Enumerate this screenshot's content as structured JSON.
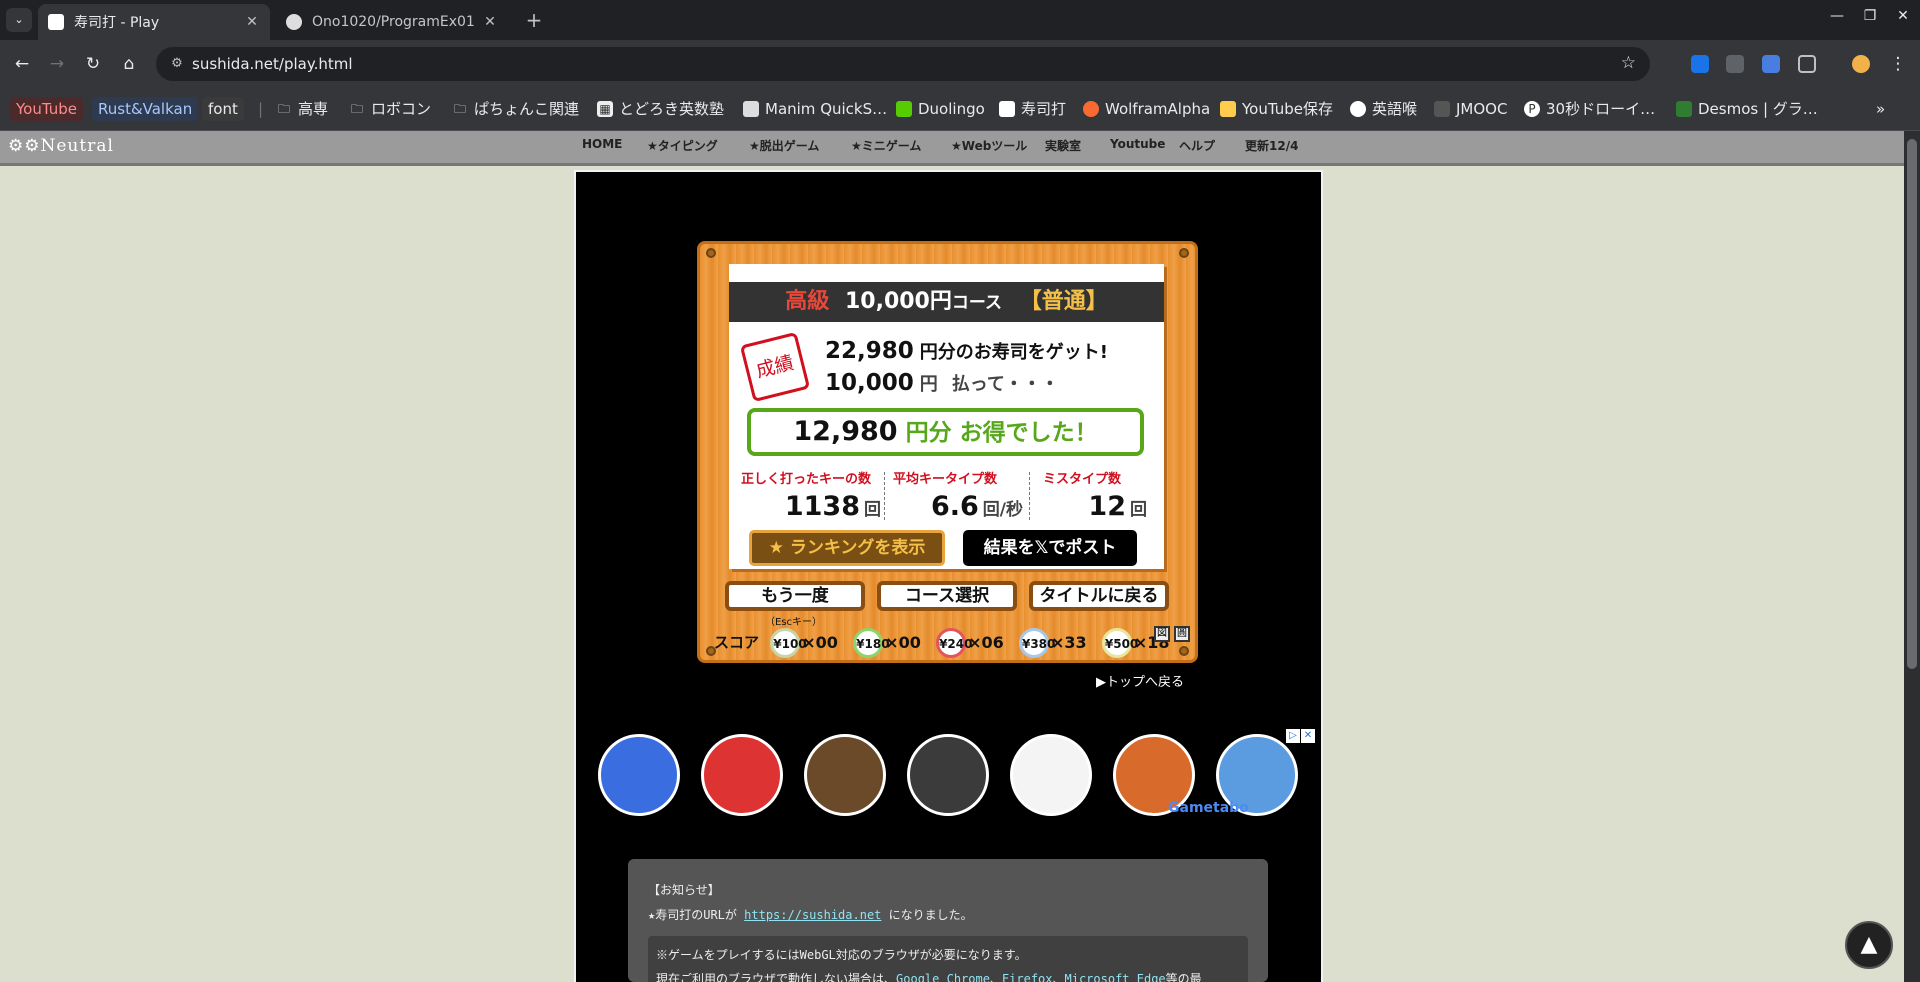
{
  "browser": {
    "tabs": [
      {
        "title": "寿司打 - Play",
        "active": true
      },
      {
        "title": "Ono1020/ProgramEx01",
        "active": false
      }
    ],
    "url": "sushida.net/play.html",
    "bookmarks": [
      "YouTube",
      "Rust&Valkan",
      "font",
      "高専",
      "ロボコン",
      "ぱちょんこ関連",
      "とどろき英数塾",
      "Manim QuickS…",
      "Duolingo",
      "寿司打",
      "WolframAlpha",
      "YouTube保存",
      "英語喉",
      "JMOOC",
      "30秒ドローイ…",
      "Desmos | グラ…"
    ],
    "bookmarks_overflow": "»"
  },
  "site": {
    "logo": "Neutral",
    "nav": [
      "HOME",
      "★タイピング",
      "★脱出ゲーム",
      "★ミニゲーム",
      "★Webツール",
      "実験室",
      "Youtube",
      "ヘルプ",
      "更新12/4"
    ]
  },
  "result": {
    "course_grade": "高級",
    "course_amount": "10,000円",
    "course_suffix": "コース",
    "difficulty": "【普通】",
    "stamp": "成績",
    "earned_value": "22,980",
    "earned_text": "円分のお寿司をゲット!",
    "paid_value": "10,000",
    "paid_unit": "円",
    "paid_text": "払って・・・",
    "profit_value": "12,980",
    "profit_text": "円分 お得でした！",
    "stats": [
      {
        "label": "正しく打ったキーの数",
        "value": "1138",
        "unit": "回"
      },
      {
        "label": "平均キータイプ数",
        "value": "6.6",
        "unit": "回/秒"
      },
      {
        "label": "ミスタイプ数",
        "value": "12",
        "unit": "回"
      }
    ],
    "ranking_button": "ランキングを表示",
    "post_button": "結果を𝕏でポスト",
    "retry_button": "もう一度",
    "retry_hint": "（Escキー）",
    "course_button": "コース選択",
    "title_button": "タイトルに戻る",
    "score_label": "スコア",
    "plates": [
      {
        "price": "¥100",
        "count": "×00",
        "color": "#c9d4a8"
      },
      {
        "price": "¥180",
        "count": "×00",
        "color": "#8fd36b"
      },
      {
        "price": "¥240",
        "count": "×06",
        "color": "#e2555f"
      },
      {
        "price": "¥380",
        "count": "×33",
        "color": "#a8c8e8"
      },
      {
        "price": "¥500",
        "count": "×18",
        "color": "#e6e6a0"
      }
    ],
    "mini_icons": [
      "図",
      "圓"
    ]
  },
  "back_to_top": "▶トップへ戻る",
  "games": [
    {
      "name": "snake",
      "color": "#3a6ee0"
    },
    {
      "name": "mario",
      "color": "#d33"
    },
    {
      "name": "minecraft",
      "color": "#6b4a2a"
    },
    {
      "name": "scary-teacher",
      "color": "#3b3b3b"
    },
    {
      "name": "baldi",
      "color": "#f4f4f4"
    },
    {
      "name": "kick-the-buddy",
      "color": "#d86b2c"
    },
    {
      "name": "subway",
      "color": "#5b9be0"
    }
  ],
  "ad_brand": "Gametabo",
  "notice": {
    "title": "【お知らせ】",
    "url_line_prefix": "★寿司打のURLが",
    "url": "https://sushida.net",
    "url_line_suffix": "になりました。",
    "webgl_line": "※ゲームをプレイするにはWebGL対応のブラウザが必要になります。",
    "browser_line_prefix": "現在ご利用のブラウザで動作しない場合は、",
    "browser_links": "Google Chrome、Firefox、Microsoft Edge",
    "browser_line_suffix": "等の最"
  }
}
